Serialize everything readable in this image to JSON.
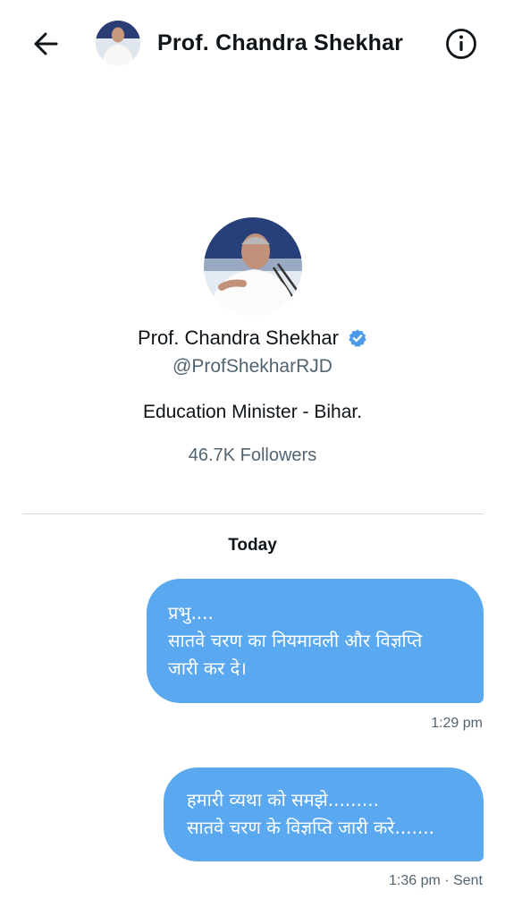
{
  "header": {
    "title": "Prof. Chandra Shekhar",
    "back_icon": "arrow-left-icon",
    "info_icon": "info-circle-icon"
  },
  "profile": {
    "name": "Prof. Chandra Shekhar",
    "verified": true,
    "handle": "@ProfShekharRJD",
    "bio": "Education Minister - Bihar.",
    "followers": "46.7K Followers"
  },
  "conversation": {
    "date_separator": "Today",
    "messages": [
      {
        "lines": [
          "प्रभु....",
          "सातवे चरण का नियमावली और विज्ञप्ति",
          "जारी कर दे।"
        ],
        "meta": "1:29 pm"
      },
      {
        "lines": [
          "हमारी व्यथा को समझे.........",
          "सातवे चरण के विज्ञप्ति जारी करे......."
        ],
        "meta": "1:36 pm · Sent"
      }
    ]
  },
  "colors": {
    "bubble": "#5aa9f0",
    "verified_badge": "#4c9be8",
    "muted_text": "#536471",
    "divider": "#cfd9de"
  }
}
